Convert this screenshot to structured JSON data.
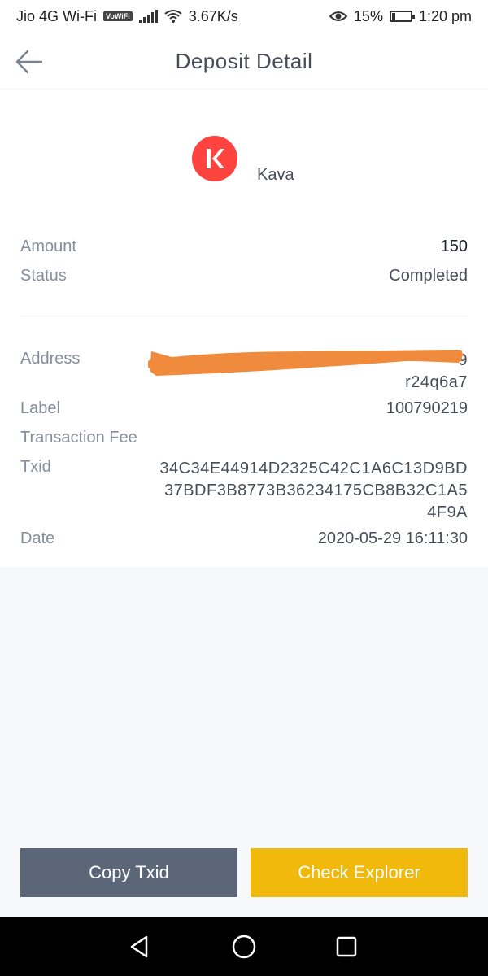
{
  "status_bar": {
    "carrier": "Jio 4G Wi-Fi",
    "volte_badge": "VoWiFi",
    "speed": "3.67K/s",
    "battery": "15%",
    "time": "1:20 pm"
  },
  "header": {
    "title": "Deposit Detail"
  },
  "coin": {
    "name": "Kava",
    "logo_letter": "K",
    "logo_color": "#ff433e"
  },
  "summary": {
    "amount_label": "Amount",
    "amount_value": "150",
    "status_label": "Status",
    "status_value": "Completed"
  },
  "details": {
    "address_label": "Address",
    "address_visible_end": "9",
    "address_line2": "r24q6a7",
    "label_label": "Label",
    "label_value": "100790219",
    "fee_label": "Transaction Fee",
    "fee_value": "",
    "txid_label": "Txid",
    "txid_line1": "34C34E44914D2325C42C1A6C13D9BD",
    "txid_line2": "37BDF3B8773B36234175CB8B32C1A5",
    "txid_line3": "4F9A",
    "date_label": "Date",
    "date_value": "2020-05-29 16:11:30"
  },
  "actions": {
    "copy_label": "Copy Txid",
    "explorer_label": "Check Explorer",
    "copy_color": "#5b6679",
    "explorer_color": "#f0b90b"
  },
  "redaction_color": "#f08a3c"
}
